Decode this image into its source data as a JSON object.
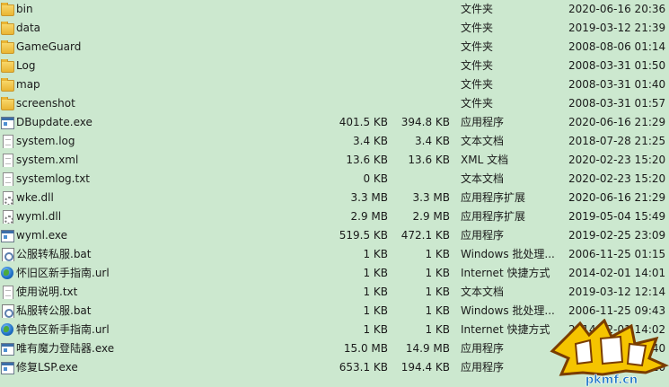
{
  "files": [
    {
      "name": "bin",
      "size": "",
      "packed": "",
      "type": "文件夹",
      "date": "2020-06-16 20:36",
      "icon": "folder-icon"
    },
    {
      "name": "data",
      "size": "",
      "packed": "",
      "type": "文件夹",
      "date": "2019-03-12 21:39",
      "icon": "folder-icon"
    },
    {
      "name": "GameGuard",
      "size": "",
      "packed": "",
      "type": "文件夹",
      "date": "2008-08-06 01:14",
      "icon": "folder-icon"
    },
    {
      "name": "Log",
      "size": "",
      "packed": "",
      "type": "文件夹",
      "date": "2008-03-31 01:50",
      "icon": "folder-icon"
    },
    {
      "name": "map",
      "size": "",
      "packed": "",
      "type": "文件夹",
      "date": "2008-03-31 01:40",
      "icon": "folder-icon"
    },
    {
      "name": "screenshot",
      "size": "",
      "packed": "",
      "type": "文件夹",
      "date": "2008-03-31 01:57",
      "icon": "folder-icon"
    },
    {
      "name": "DBupdate.exe",
      "size": "401.5 KB",
      "packed": "394.8 KB",
      "type": "应用程序",
      "date": "2020-06-16 21:29",
      "icon": "exe-icon"
    },
    {
      "name": "system.log",
      "size": "3.4 KB",
      "packed": "3.4 KB",
      "type": "文本文档",
      "date": "2018-07-28 21:25",
      "icon": "document-icon"
    },
    {
      "name": "system.xml",
      "size": "13.6 KB",
      "packed": "13.6 KB",
      "type": "XML 文档",
      "date": "2020-02-23 15:20",
      "icon": "document-icon"
    },
    {
      "name": "systemlog.txt",
      "size": "0 KB",
      "packed": "",
      "type": "文本文档",
      "date": "2020-02-23 15:20",
      "icon": "document-icon"
    },
    {
      "name": "wke.dll",
      "size": "3.3 MB",
      "packed": "3.3 MB",
      "type": "应用程序扩展",
      "date": "2020-06-16 21:29",
      "icon": "dll-icon"
    },
    {
      "name": "wyml.dll",
      "size": "2.9 MB",
      "packed": "2.9 MB",
      "type": "应用程序扩展",
      "date": "2019-05-04 15:49",
      "icon": "dll-icon"
    },
    {
      "name": "wyml.exe",
      "size": "519.5 KB",
      "packed": "472.1 KB",
      "type": "应用程序",
      "date": "2019-02-25 23:09",
      "icon": "exe-icon"
    },
    {
      "name": "公服转私服.bat",
      "size": "1 KB",
      "packed": "1 KB",
      "type": "Windows 批处理...",
      "date": "2006-11-25 01:15",
      "icon": "bat-icon"
    },
    {
      "name": "怀旧区新手指南.url",
      "size": "1 KB",
      "packed": "1 KB",
      "type": "Internet 快捷方式",
      "date": "2014-02-01 14:01",
      "icon": "globe-icon"
    },
    {
      "name": "使用说明.txt",
      "size": "1 KB",
      "packed": "1 KB",
      "type": "文本文档",
      "date": "2019-03-12 12:14",
      "icon": "document-icon"
    },
    {
      "name": "私服转公服.bat",
      "size": "1 KB",
      "packed": "1 KB",
      "type": "Windows 批处理...",
      "date": "2006-11-25 09:43",
      "icon": "bat-icon"
    },
    {
      "name": "特色区新手指南.url",
      "size": "1 KB",
      "packed": "1 KB",
      "type": "Internet 快捷方式",
      "date": "2014-02-01 14:02",
      "icon": "globe-icon"
    },
    {
      "name": "唯有魔力登陆器.exe",
      "size": "15.0 MB",
      "packed": "14.9 MB",
      "type": "应用程序",
      "date": "2018-03-12 21:40",
      "icon": "exe-icon"
    },
    {
      "name": "修复LSP.exe",
      "size": "653.1 KB",
      "packed": "194.4 KB",
      "type": "应用程序",
      "date": "2019-05-04 21:10",
      "icon": "exe-icon"
    }
  ],
  "watermark": {
    "domain": "pkmf.cn",
    "colors": {
      "accent": "#f5c400",
      "outline": "#7a3d00",
      "text": "#1a73c7"
    }
  }
}
